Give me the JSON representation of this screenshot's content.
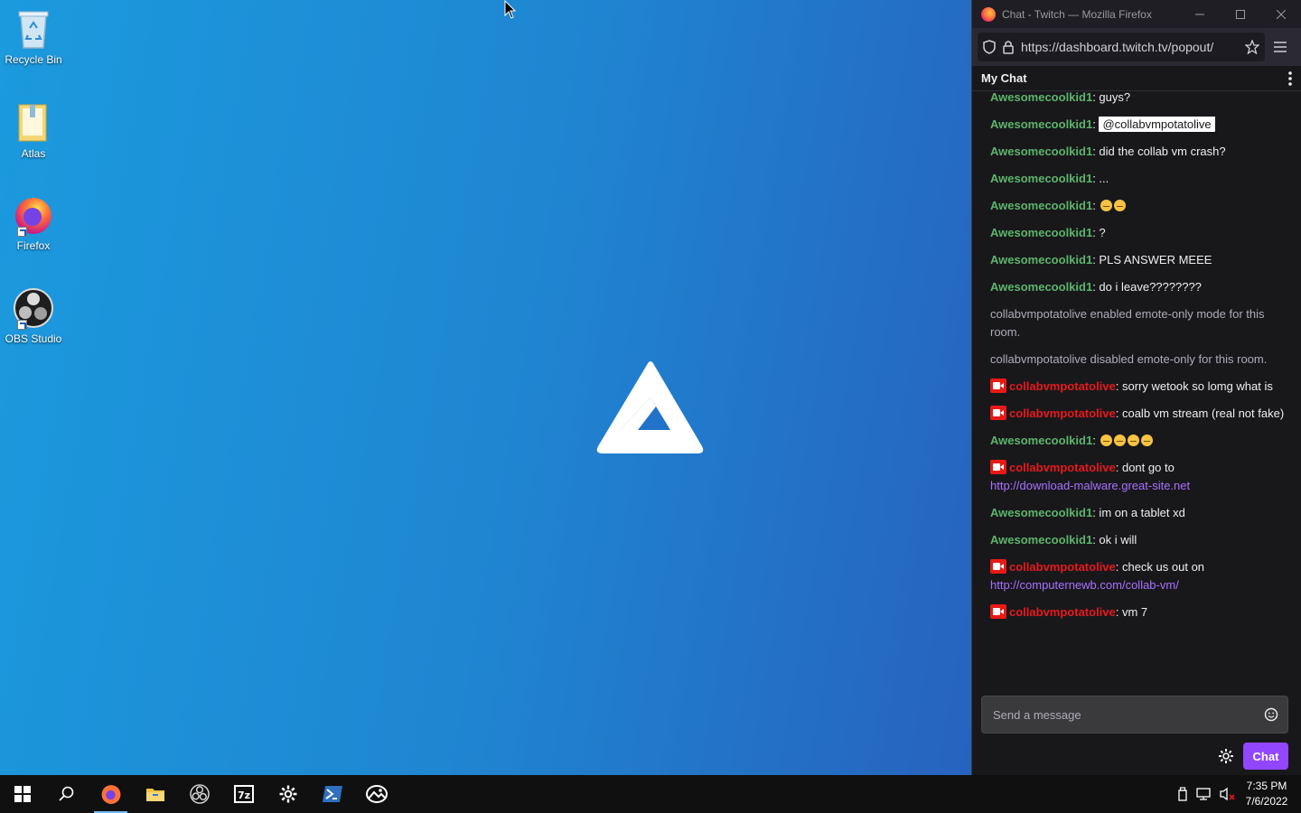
{
  "desktop": {
    "icons": [
      {
        "label": "Recycle Bin",
        "icon": "recycle-bin-icon"
      },
      {
        "label": "Atlas",
        "icon": "folder-icon"
      },
      {
        "label": "Firefox",
        "icon": "firefox-icon"
      },
      {
        "label": "OBS Studio",
        "icon": "obs-icon"
      }
    ]
  },
  "browser": {
    "title": "Chat - Twitch — Mozilla Firefox",
    "url": "https://dashboard.twitch.tv/popout/"
  },
  "chat": {
    "header": "My Chat",
    "messages": [
      {
        "user": "Awesomecoolkid1",
        "text": ": guys?"
      },
      {
        "user": "Awesomecoolkid1",
        "mention": "@collabvmpotatolive"
      },
      {
        "user": "Awesomecoolkid1",
        "text": ": did the collab vm crash?"
      },
      {
        "user": "Awesomecoolkid1",
        "text": ": ..."
      },
      {
        "user": "Awesomecoolkid1",
        "text": ": "
      },
      {
        "user": "Awesomecoolkid1",
        "text": ": ?"
      },
      {
        "user": "Awesomecoolkid1",
        "text": ": PLS ANSWER MEEE"
      },
      {
        "user": "Awesomecoolkid1",
        "text": ": do i leave????????"
      },
      {
        "system": "collabvmpotatolive enabled emote-only mode for this room."
      },
      {
        "system": "collabvmpotatolive disabled emote-only for this room."
      },
      {
        "user": "collabvmpotatolive",
        "text": ": sorry wetook so lomg what is"
      },
      {
        "user": "collabvmpotatolive",
        "text": ": coalb vm stream (real not fake)"
      },
      {
        "user": "Awesomecoolkid1",
        "text": ": "
      },
      {
        "user": "collabvmpotatolive",
        "text": ": dont go to",
        "link": "http://download-malware.great-site.net"
      },
      {
        "user": "Awesomecoolkid1",
        "text": ": im on a tablet xd"
      },
      {
        "user": "Awesomecoolkid1",
        "text": ": ok i will"
      },
      {
        "user": "collabvmpotatolive",
        "text": ": check us out on",
        "link": "http://computernewb.com/collab-vm/"
      },
      {
        "user": "collabvmpotatolive",
        "text": ": vm 7"
      }
    ],
    "input_placeholder": "Send a message",
    "send_label": "Chat"
  },
  "taskbar": {
    "time": "7:35 PM",
    "date": "7/6/2022"
  }
}
